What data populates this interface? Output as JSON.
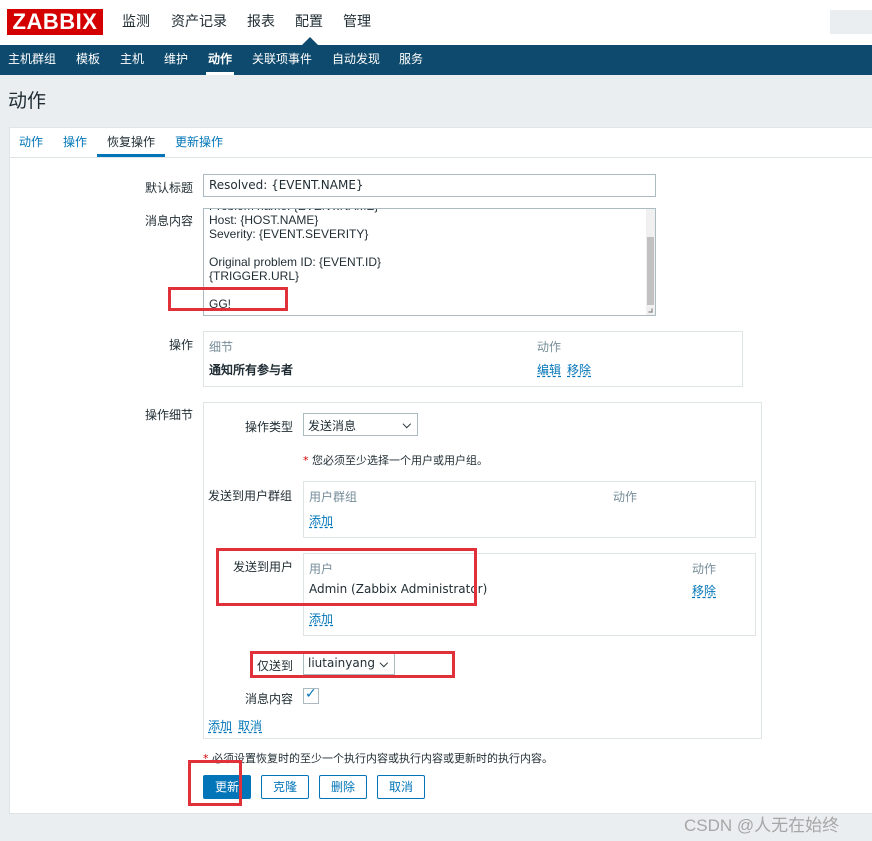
{
  "header": {
    "logo": "ZABBIX",
    "nav": [
      "监测",
      "资产记录",
      "报表",
      "配置",
      "管理"
    ],
    "active_nav": "配置"
  },
  "subnav": {
    "items": [
      "主机群组",
      "模板",
      "主机",
      "维护",
      "动作",
      "关联项事件",
      "自动发现",
      "服务"
    ],
    "active": "动作"
  },
  "page": {
    "title": "动作"
  },
  "tabs": {
    "items": [
      "动作",
      "操作",
      "恢复操作",
      "更新操作"
    ],
    "active": "恢复操作"
  },
  "form": {
    "default_subject_label": "默认标题",
    "default_subject_value": "Resolved: {EVENT.NAME}",
    "message_label": "消息内容",
    "message_value": "Problem name: {EVENT.NAME}\nHost: {HOST.NAME}\nSeverity: {EVENT.SEVERITY}\n\nOriginal problem ID: {EVENT.ID}\n{TRIGGER.URL}\n\nGG!",
    "operations_label": "操作",
    "operations_table": {
      "col_details": "细节",
      "col_action": "动作",
      "row_details": "通知所有参与者",
      "edit": "编辑",
      "remove": "移除"
    },
    "op_details_label": "操作细节",
    "op_type_label": "操作类型",
    "op_type_value": "发送消息",
    "required_note": "您必须至少选择一个用户或用户组。",
    "send_to_groups_label": "发送到用户群组",
    "groups_table": {
      "col_group": "用户群组",
      "col_action": "动作",
      "add": "添加"
    },
    "send_to_users_label": "发送到用户",
    "users_table": {
      "col_user": "用户",
      "col_action": "动作",
      "user": "Admin (Zabbix Administrator)",
      "remove": "移除",
      "add": "添加"
    },
    "send_only_to_label": "仅送到",
    "send_only_to_value": "liutainyang",
    "message_content_label": "消息内容",
    "message_content_checked": true,
    "detail_add": "添加",
    "detail_cancel": "取消",
    "bottom_note": "必须设置恢复时的至少一个执行内容或执行内容或更新时的执行内容。"
  },
  "buttons": {
    "update": "更新",
    "clone": "克隆",
    "delete": "删除",
    "cancel": "取消"
  },
  "watermark": "CSDN @人无在始终",
  "colors": {
    "brand_red": "#d40000",
    "nav_blue": "#0e4a6d",
    "link_blue": "#0275b8",
    "highlight_red": "#e0303a"
  }
}
